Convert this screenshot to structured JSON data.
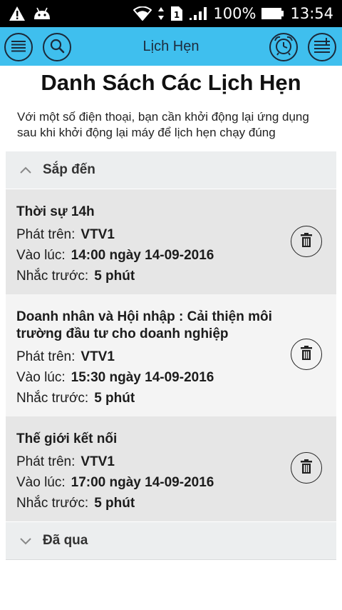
{
  "status_bar": {
    "battery": "100%",
    "time": "13:54",
    "icons": [
      "warning-icon",
      "android-icon",
      "wifi-icon",
      "data-arrows-icon",
      "sim-icon",
      "signal-icon",
      "battery-icon"
    ]
  },
  "app_bar": {
    "title": "Lịch Hẹn",
    "icons": [
      "menu-icon",
      "search-icon",
      "alarm-clock-icon",
      "add-list-icon"
    ],
    "color": "#3fbfee"
  },
  "page": {
    "title": "Danh Sách Các Lịch Hẹn",
    "notice": "Với một số điện thoại, bạn cần khởi động lại ứng dụng sau khi khởi động lại máy để lịch hẹn chạy đúng"
  },
  "sections": {
    "upcoming": {
      "label": "Sắp đến",
      "expanded": true
    },
    "past": {
      "label": "Đã qua",
      "expanded": false
    }
  },
  "labels": {
    "channel": "Phát trên:",
    "time": "Vào lúc:",
    "remind": "Nhắc trước:"
  },
  "appointments": [
    {
      "name": "Thời sự 14h",
      "channel": "VTV1",
      "time": "14:00 ngày 14-09-2016",
      "remind": "5 phút",
      "bg": "#e6e6e6"
    },
    {
      "name": "Doanh nhân và Hội nhập : Cải thiện môi trường đầu tư cho doanh nghiệp",
      "channel": "VTV1",
      "time": "15:30 ngày 14-09-2016",
      "remind": "5 phút",
      "bg": "#f4f4f4"
    },
    {
      "name": "Thế giới kết nối",
      "channel": "VTV1",
      "time": "17:00 ngày 14-09-2016",
      "remind": "5 phút",
      "bg": "#e6e6e6"
    }
  ]
}
